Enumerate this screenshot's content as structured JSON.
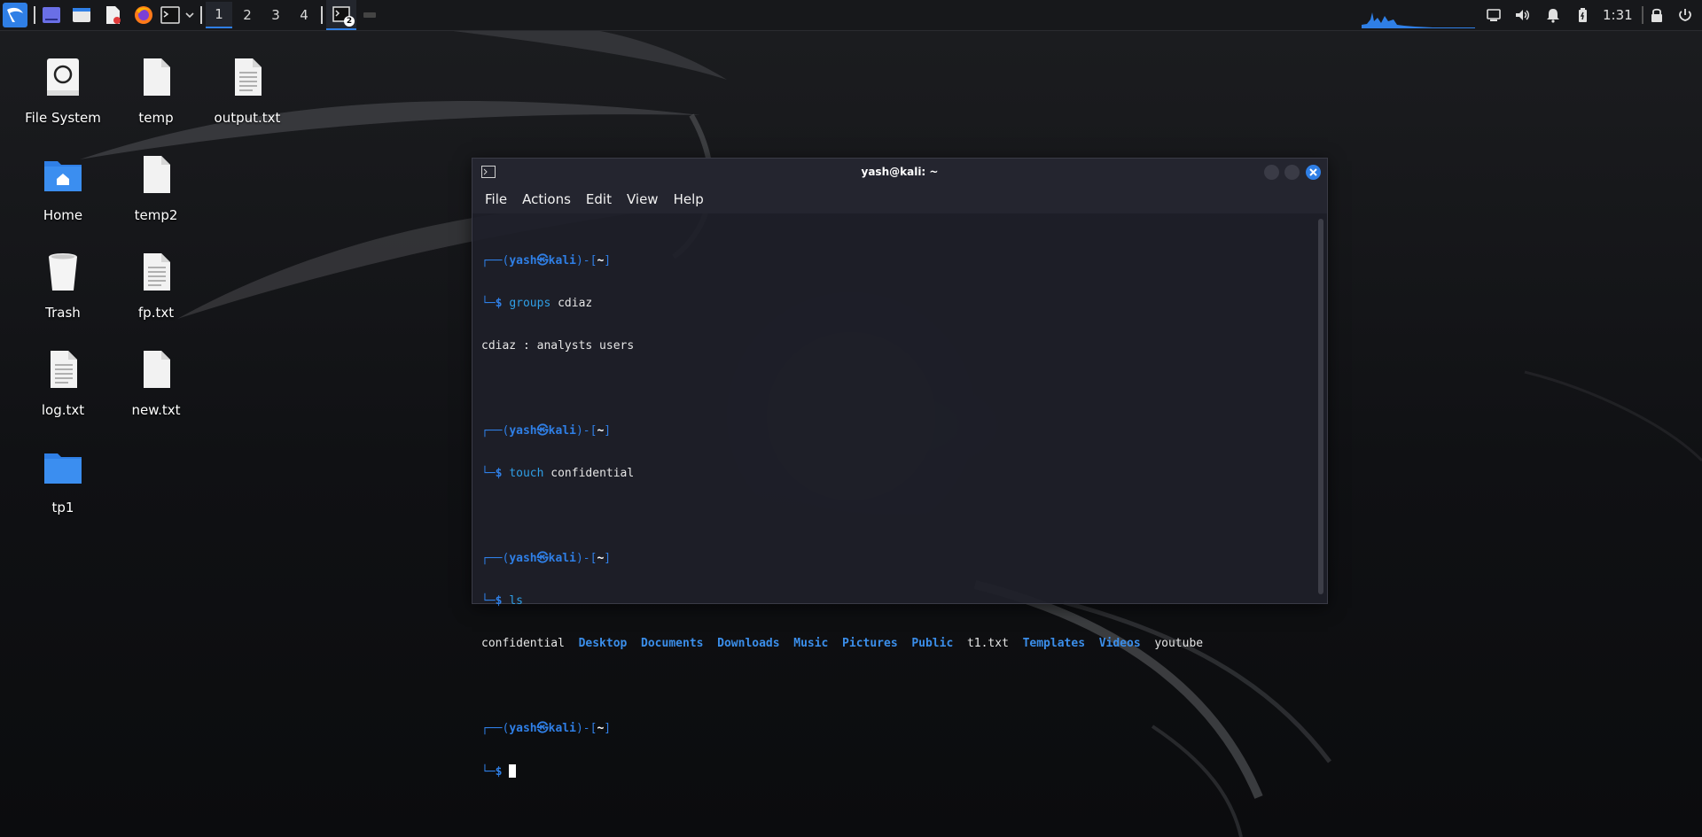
{
  "panel": {
    "workspaces": [
      "1",
      "2",
      "3",
      "4"
    ],
    "active_workspace": "1",
    "task_badge": "2",
    "clock": "1:31"
  },
  "desktop": {
    "icons": [
      {
        "label": "File System",
        "icon": "drive-icon"
      },
      {
        "label": "temp",
        "icon": "file-icon"
      },
      {
        "label": "output.txt",
        "icon": "text-file-icon"
      },
      {
        "label": "Home",
        "icon": "home-folder-icon"
      },
      {
        "label": "temp2",
        "icon": "file-icon"
      },
      {
        "label": "Trash",
        "icon": "trash-icon"
      },
      {
        "label": "fp.txt",
        "icon": "text-file-icon"
      },
      {
        "label": "log.txt",
        "icon": "text-file-icon"
      },
      {
        "label": "new.txt",
        "icon": "file-icon"
      },
      {
        "label": "tp1",
        "icon": "folder-icon"
      }
    ]
  },
  "terminal": {
    "title": "yash@kali: ~",
    "menu": [
      "File",
      "Actions",
      "Edit",
      "View",
      "Help"
    ],
    "prompt": {
      "open": "┌──(",
      "user": "yash",
      "at": "㉿",
      "host": "kali",
      "mid": ")-[",
      "dir": "~",
      "close": "]",
      "second": "└─",
      "dollar": "$"
    },
    "commands": [
      {
        "cmd": "groups",
        "args": "cdiaz",
        "output": "cdiaz : analysts users"
      },
      {
        "cmd": "touch",
        "args": "confidential"
      },
      {
        "cmd": "ls",
        "args": ""
      }
    ],
    "ls_entries": [
      {
        "name": "confidential",
        "type": "file"
      },
      {
        "name": "Desktop",
        "type": "dir"
      },
      {
        "name": "Documents",
        "type": "dir"
      },
      {
        "name": "Downloads",
        "type": "dir"
      },
      {
        "name": "Music",
        "type": "dir"
      },
      {
        "name": "Pictures",
        "type": "dir"
      },
      {
        "name": "Public",
        "type": "dir"
      },
      {
        "name": "t1.txt",
        "type": "file"
      },
      {
        "name": "Templates",
        "type": "dir"
      },
      {
        "name": "Videos",
        "type": "dir"
      },
      {
        "name": "youtube",
        "type": "file"
      }
    ]
  },
  "colors": {
    "accent": "#2f7fe6",
    "panel_bg": "#17181b",
    "terminal_bg": "#1e1f29",
    "close_button": "#2f7fe6"
  }
}
